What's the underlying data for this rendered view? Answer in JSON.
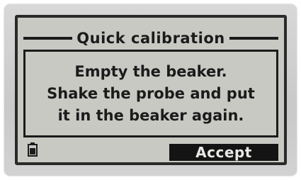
{
  "screen": {
    "title": "Quick calibration",
    "message_lines": [
      "Empty the beaker.",
      "Shake the probe and put",
      "it in the beaker again."
    ],
    "accept_label": "Accept",
    "battery_icon": "battery-icon"
  },
  "colors": {
    "lcd_background": "#c9c9c4",
    "lcd_foreground": "#1b1b1b",
    "button_background": "#141414",
    "button_text": "#e8e8e4"
  }
}
